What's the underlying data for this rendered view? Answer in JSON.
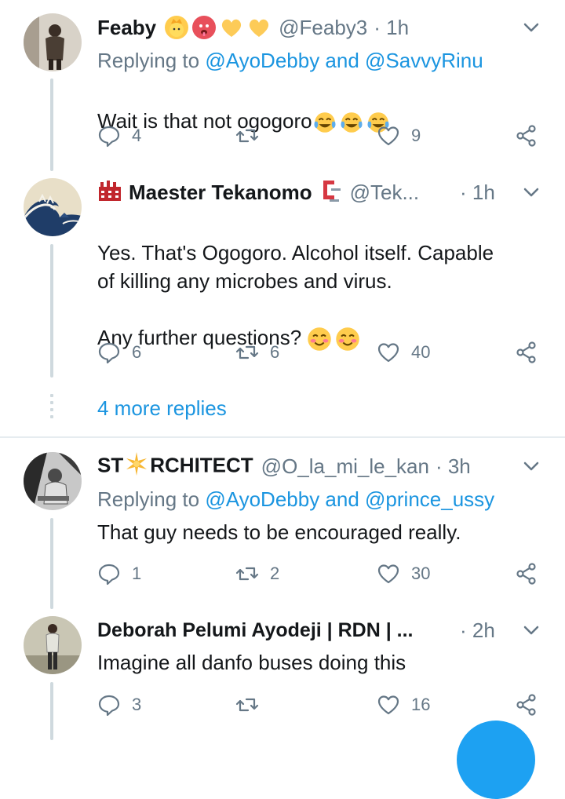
{
  "tweets": [
    {
      "name": "Feaby",
      "handle": "@Feaby3",
      "time": "· 1h",
      "replying_prefix": "Replying to ",
      "replying_user1": "@AyoDebby",
      "replying_and": " and ",
      "replying_user2": "@SavvyRinu",
      "text": "Wait is that not ogogoro",
      "replies": "4",
      "retweets": "",
      "likes": "9"
    },
    {
      "name": "Maester Tekanomo",
      "handle": "@Tek...",
      "time": "· 1h",
      "text": "Yes. That's Ogogoro. Alcohol itself. Capable\nof killing any microbes and virus.\n\nAny further questions?",
      "replies": "6",
      "retweets": "6",
      "likes": "40",
      "more_replies": "4 more replies"
    },
    {
      "name": "ST☀RCHITECT",
      "name_part1": "ST",
      "name_part2": "RCHITECT",
      "handle": "@O_la_mi_le_kan",
      "time": "· 3h",
      "replying_prefix": "Replying to ",
      "replying_user1": "@AyoDebby",
      "replying_and": " and ",
      "replying_user2": "@prince_ussy",
      "text": "That guy needs to be encouraged really.",
      "replies": "1",
      "retweets": "2",
      "likes": "30"
    },
    {
      "name": "Deborah Pelumi Ayodeji | RDN | ...",
      "handle": "",
      "time": "· 2h",
      "text": "Imagine all danfo buses doing this",
      "replies": "3",
      "retweets": "",
      "likes": "16"
    }
  ],
  "colors": {
    "link": "#1b95e0",
    "muted": "#657786",
    "text": "#14171a",
    "thread_line": "#cfd9de",
    "fab": "#1da1f2"
  },
  "icons": [
    "reply-icon",
    "retweet-icon",
    "like-icon",
    "share-icon",
    "chevron-down-icon"
  ]
}
